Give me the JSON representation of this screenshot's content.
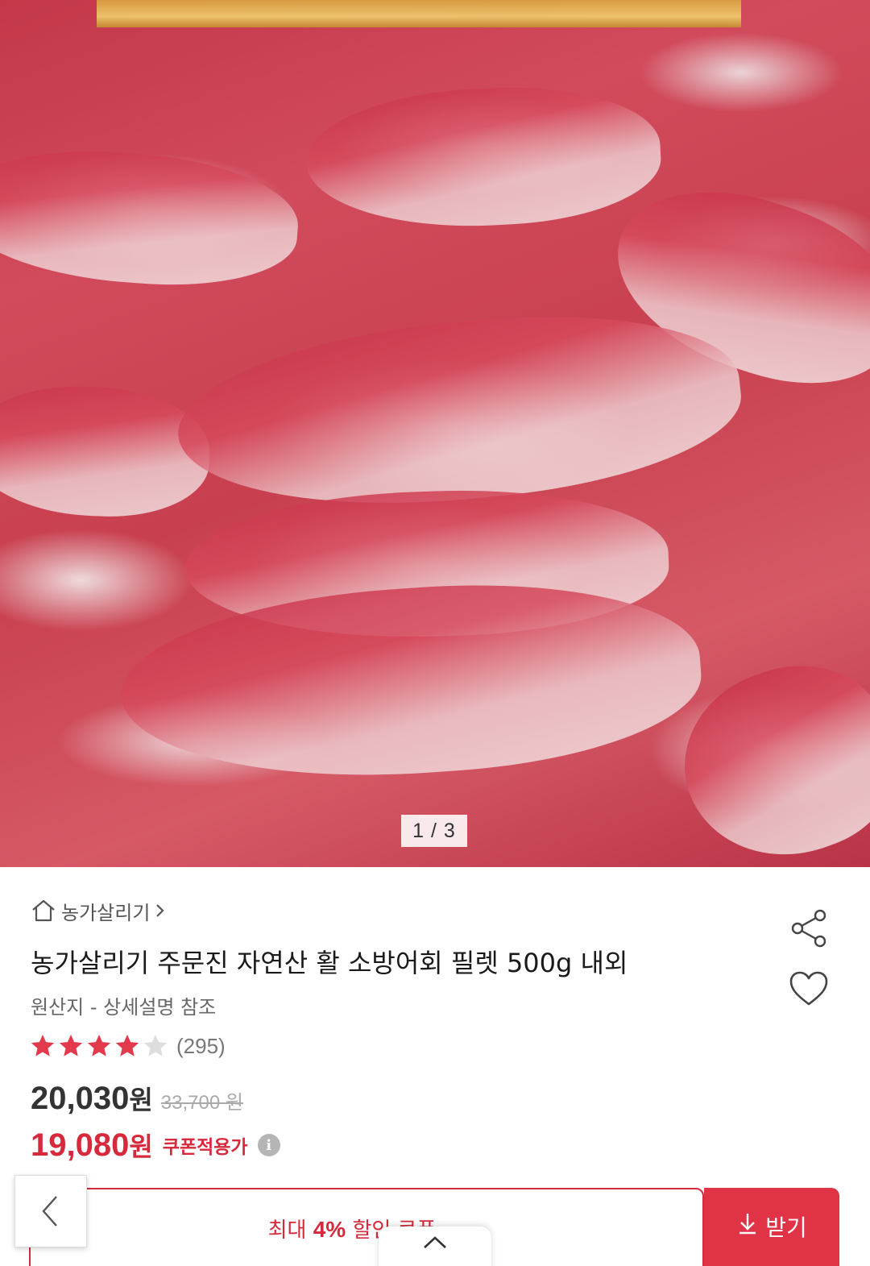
{
  "gallery": {
    "counter": "1 / 3"
  },
  "breadcrumb": {
    "label": "농가살리기",
    "home_icon": "home-icon",
    "chevron_icon": "chevron-right-icon"
  },
  "product": {
    "title": "농가살리기 주문진 자연산 활 소방어회 필렛 500g 내외",
    "origin": "원산지 - 상세설명 참조",
    "rating": 4,
    "rating_max": 5,
    "review_count": "(295)",
    "price": "20,030",
    "price_unit": "원",
    "original_price": "33,700 원",
    "coupon_price": "19,080",
    "coupon_price_unit": "원",
    "coupon_price_label": "쿠폰적용가",
    "info_icon": "info-icon"
  },
  "actions": {
    "share_icon": "share-icon",
    "heart_icon": "heart-icon"
  },
  "coupon_bar": {
    "prefix": "최대",
    "percent": "4%",
    "suffix": "할인 쿠폰",
    "receive_label": "받기",
    "download_icon": "download-icon",
    "back_icon": "chevron-left-icon",
    "collapse_icon": "chevron-up-icon"
  },
  "colors": {
    "accent": "#d6293b",
    "star": "#e23a4c",
    "star_empty": "#dddddd",
    "button": "#e03346"
  }
}
